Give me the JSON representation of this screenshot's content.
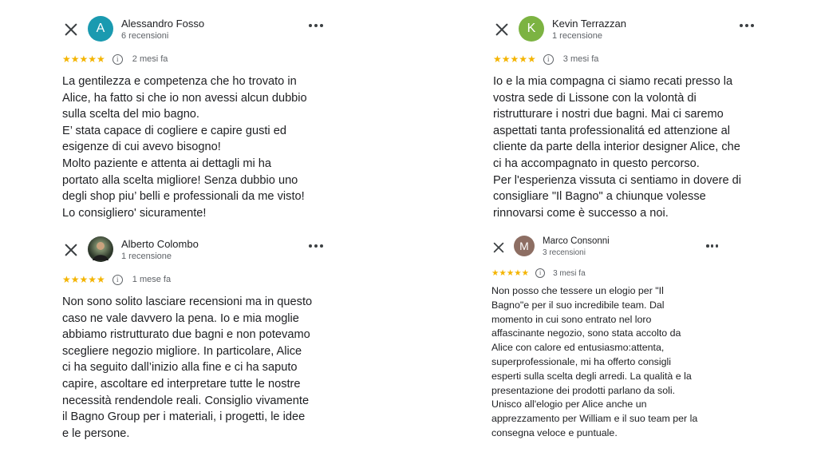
{
  "reviews": [
    {
      "author": "Alessandro Fosso",
      "initial": "A",
      "avatar_color": "#1a9ab0",
      "review_count": "6 recensioni",
      "stars": "★★★★★",
      "info_icon": "i",
      "date": "2 mesi fa",
      "text": "La gentilezza e competenza che ho trovato in\nAlice, ha fatto si che io non avessi alcun dubbio\nsulla scelta del mio bagno.\nE’ stata capace di cogliere e capire gusti ed\nesigenze di cui avevo bisogno!\nMolto paziente e attenta ai dettagli mi ha\nportato alla scelta migliore! Senza dubbio uno\ndegli shop piu’ belli e professionali da me visto!\nLo consigliero' sicuramente!"
    },
    {
      "author": "Kevin Terrazzan",
      "initial": "K",
      "avatar_color": "#7cb342",
      "review_count": "1 recensione",
      "stars": "★★★★★",
      "info_icon": "i",
      "date": "3 mesi fa",
      "text": "Io e la mia compagna ci siamo recati presso la\nvostra  sede di Lissone con la volontà di\nristrutturare i nostri due bagni. Mai ci saremo\naspettati tanta professionalitá ed attenzione al\ncliente da parte della interior designer Alice, che\nci ha accompagnato in questo percorso.\nPer l'esperienza vissuta ci sentiamo in dovere di\nconsigliare \"Il Bagno\" a chiunque volesse\nrinnovarsi come è successo a noi."
    },
    {
      "author": "Alberto Colombo",
      "initial": "",
      "avatar_color": "#3d4a3a",
      "review_count": "1 recensione",
      "stars": "★★★★★",
      "info_icon": "i",
      "date": "1 mese fa",
      "text": "Non sono solito lasciare recensioni ma in questo\ncaso ne vale davvero la pena. Io e mia moglie\nabbiamo ristrutturato due bagni e non potevamo\nscegliere negozio migliore. In particolare, Alice\nci ha seguito dall’inizio alla fine e ci ha saputo\ncapire, ascoltare ed interpretare tutte le nostre\nnecessità rendendole reali. Consiglio vivamente\nil Bagno Group per i materiali, i progetti, le idee\ne le persone."
    },
    {
      "author": "Marco Consonni",
      "initial": "M",
      "avatar_color": "#8d6e63",
      "review_count": "3 recensioni",
      "stars": "★★★★★",
      "info_icon": "i",
      "date": "3 mesi fa",
      "text": "Non posso che tessere un elogio per \"Il\nBagno\"e per il suo incredibile team. Dal\nmomento in cui sono entrato nel loro\naffascinante negozio, sono stata accolto da\nAlice con calore ed entusiasmo:attenta,\nsuperprofessionale, mi ha offerto consigli\nesperti sulla scelta degli arredi. La qualità e la\npresentazione dei prodotti parlano da soli.\nUnisco all'elogio per Alice anche un\napprezzamento per William e il suo team per la\nconsegna veloce e puntuale."
    }
  ]
}
